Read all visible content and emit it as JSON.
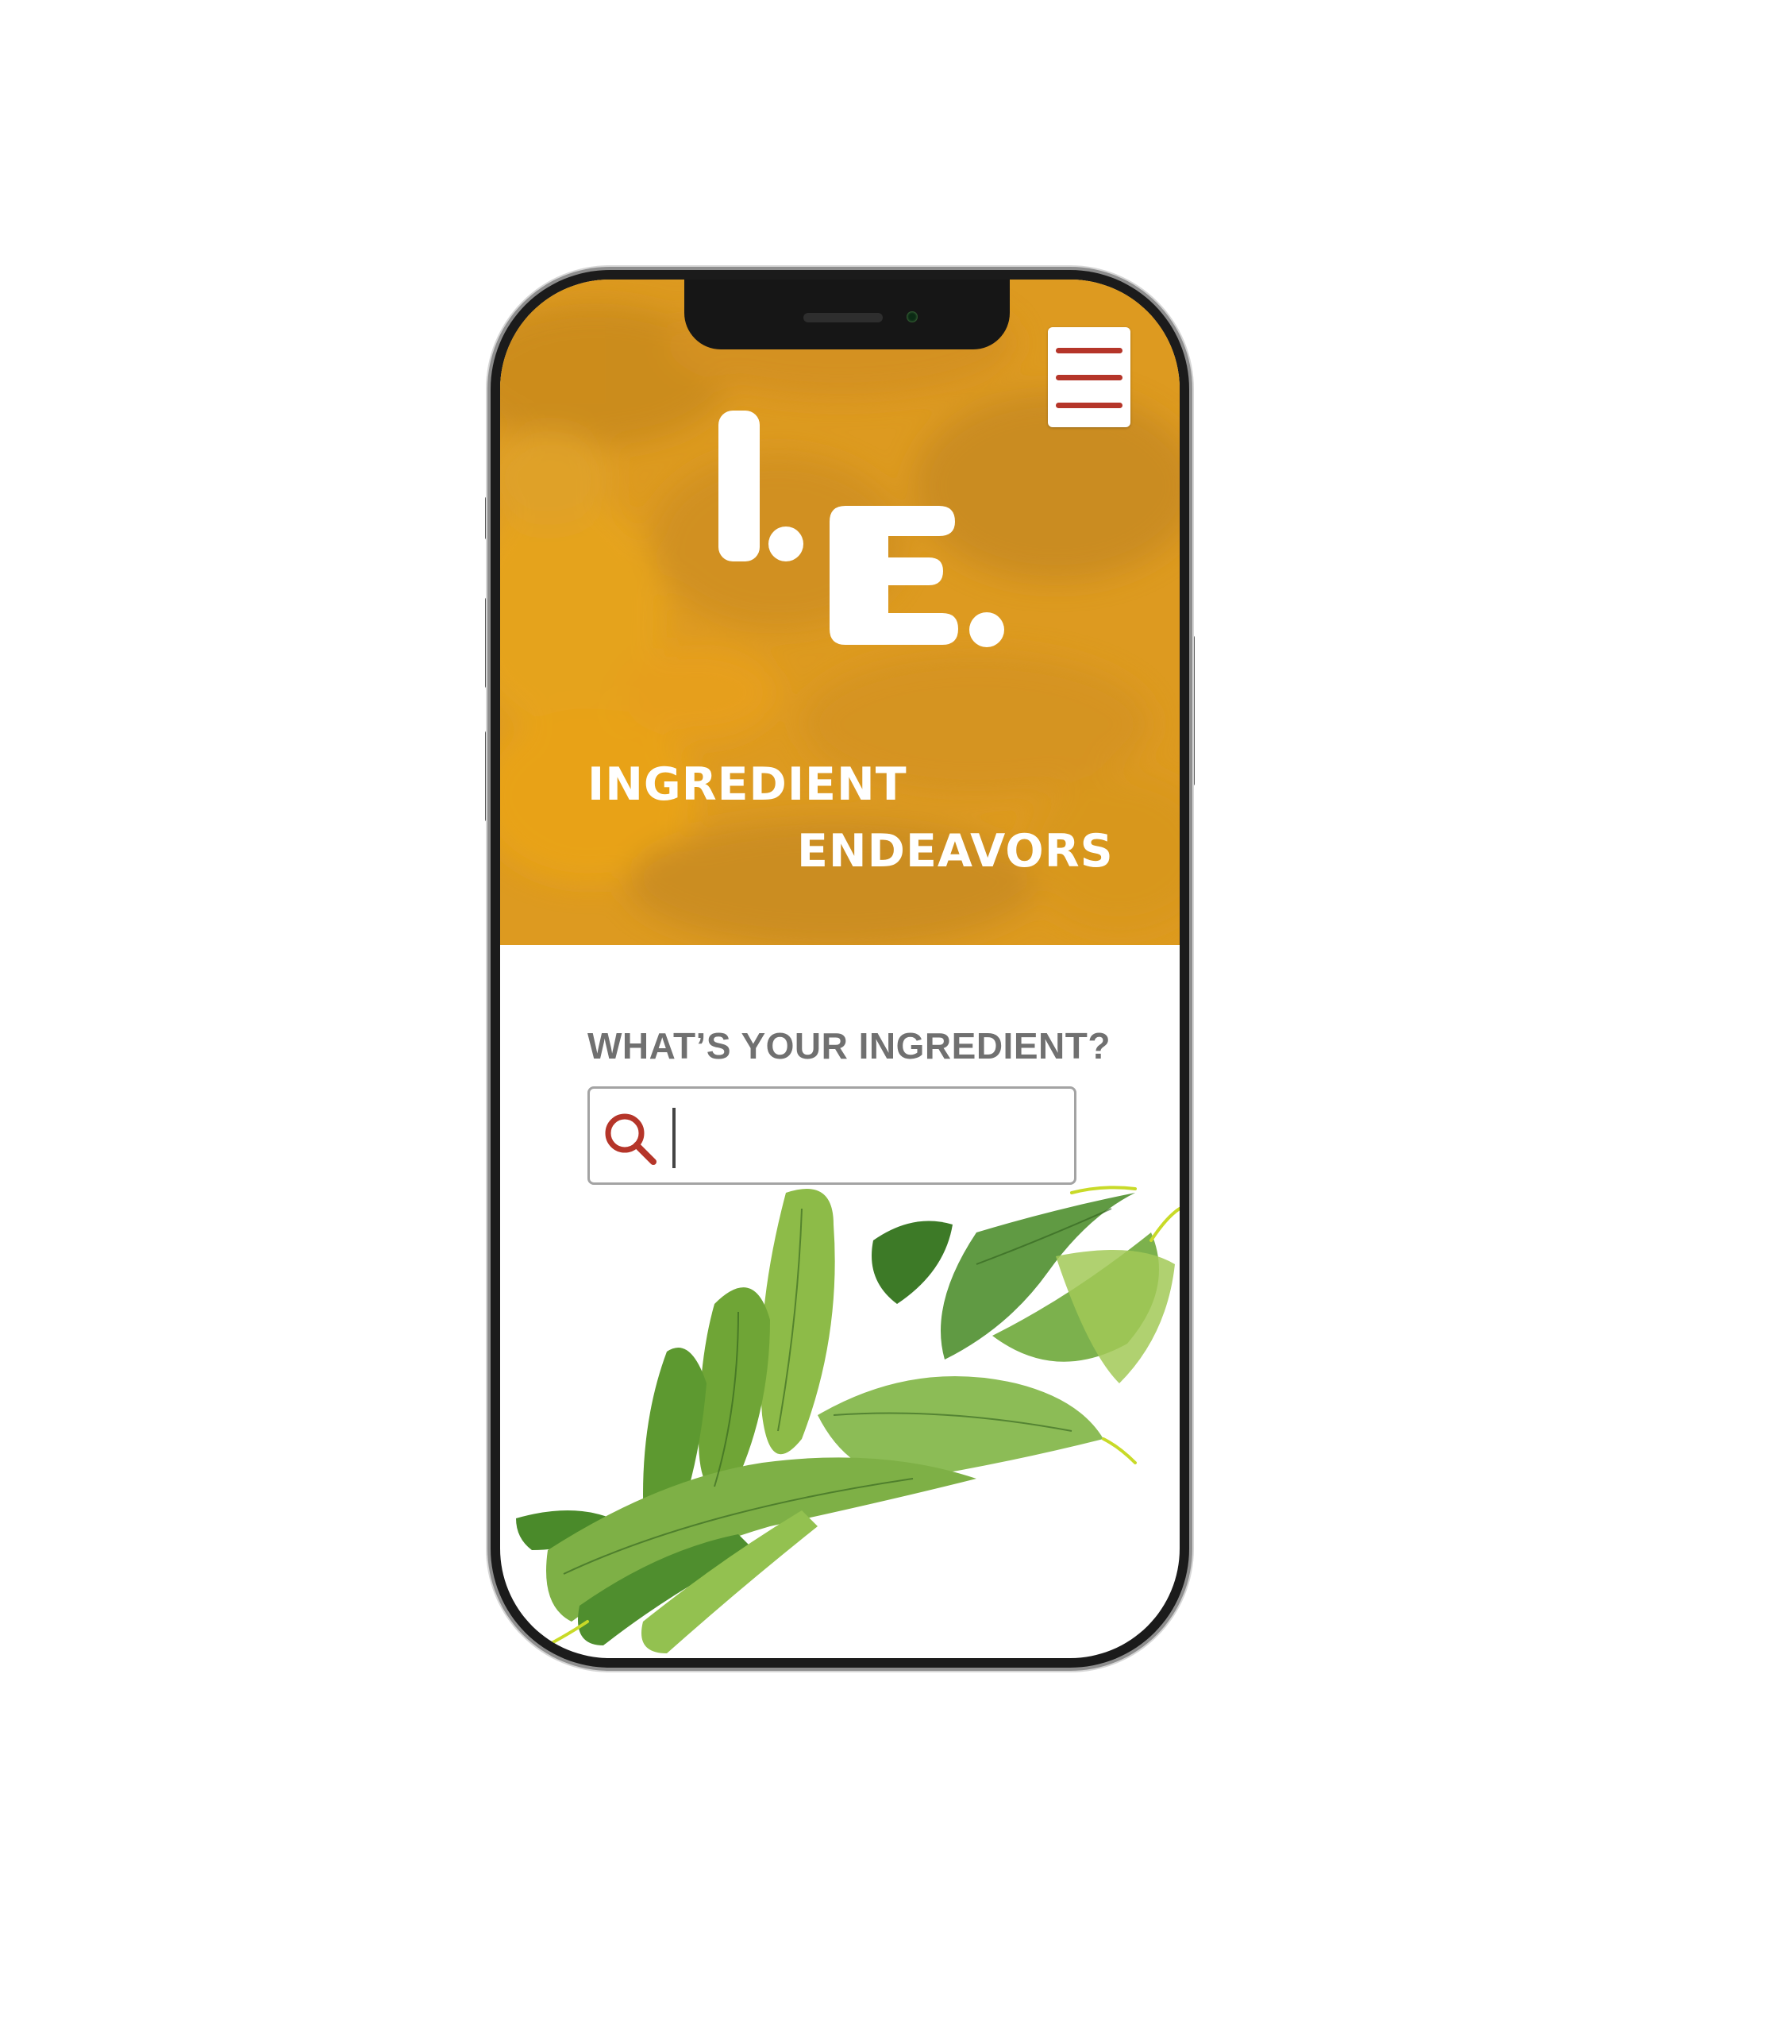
{
  "brand": {
    "logo": "I.E.",
    "name_line_1": "INGREDIENT",
    "name_line_2": "ENDEAVORS"
  },
  "header": {
    "menu_icon": "hamburger-menu-icon"
  },
  "search": {
    "prompt": "WHAT’S YOUR INGREDIENT?",
    "value": "",
    "icon": "search-icon"
  },
  "illustration": {
    "subject": "watercolor-leafy-greens"
  },
  "colors": {
    "hero": "#dd9a20",
    "accent": "#b53529",
    "prompt_text": "#707070",
    "leaf_dark": "#3f7a28",
    "leaf_light": "#9bc24a"
  }
}
